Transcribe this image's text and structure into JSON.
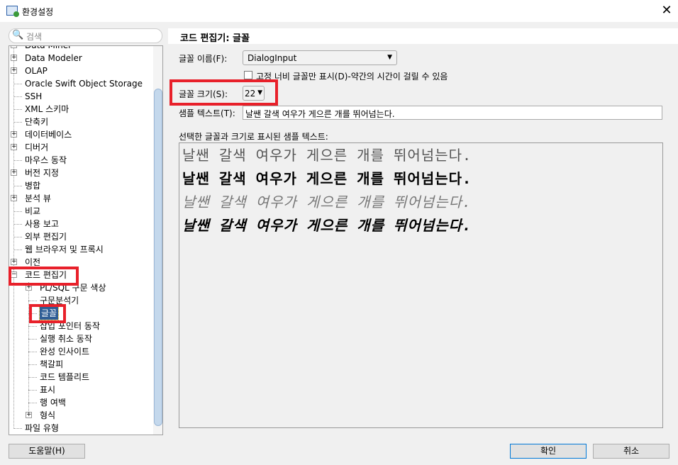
{
  "window": {
    "title": "환경설정",
    "close_glyph": "✕"
  },
  "search": {
    "placeholder": "검색"
  },
  "tree": {
    "items": [
      {
        "label": "Data Miner",
        "level": 0,
        "expander": "+"
      },
      {
        "label": "Data Modeler",
        "level": 0,
        "expander": "+"
      },
      {
        "label": "OLAP",
        "level": 0,
        "expander": "+"
      },
      {
        "label": "Oracle Swift Object Storage",
        "level": 0
      },
      {
        "label": "SSH",
        "level": 0
      },
      {
        "label": "XML 스키마",
        "level": 0
      },
      {
        "label": "단축키",
        "level": 0
      },
      {
        "label": "데이터베이스",
        "level": 0,
        "expander": "+"
      },
      {
        "label": "디버거",
        "level": 0,
        "expander": "+"
      },
      {
        "label": "마우스 동작",
        "level": 0
      },
      {
        "label": "버전 지정",
        "level": 0,
        "expander": "+"
      },
      {
        "label": "병합",
        "level": 0
      },
      {
        "label": "분석 뷰",
        "level": 0,
        "expander": "+"
      },
      {
        "label": "비교",
        "level": 0
      },
      {
        "label": "사용 보고",
        "level": 0
      },
      {
        "label": "외부 편집기",
        "level": 0
      },
      {
        "label": "웹 브라우저 및 프록시",
        "level": 0
      },
      {
        "label": "이전",
        "level": 0,
        "expander": "+"
      },
      {
        "label": "코드 편집기",
        "level": 0,
        "expander": "-"
      },
      {
        "label": "PL/SQL 구문 색상",
        "level": 1,
        "expander": "+"
      },
      {
        "label": "구문분석기",
        "level": 1
      },
      {
        "label": "글꼴",
        "level": 1,
        "selected": true
      },
      {
        "label": "삽입 포인터 동작",
        "level": 1
      },
      {
        "label": "실행 취소 동작",
        "level": 1
      },
      {
        "label": "완성 인사이트",
        "level": 1
      },
      {
        "label": "책갈피",
        "level": 1
      },
      {
        "label": "코드 템플리트",
        "level": 1
      },
      {
        "label": "표시",
        "level": 1
      },
      {
        "label": "행 여백",
        "level": 1
      },
      {
        "label": "형식",
        "level": 1,
        "expander": "+"
      },
      {
        "label": "파일 유형",
        "level": 0
      }
    ]
  },
  "panel": {
    "header": "코드 편집기: 글꼴",
    "font_name_label": "글꼴 이름(F):",
    "font_name_value": "DialogInput",
    "fixed_width_label": "고정 너비 글꼴만 표시(D)-약간의 시간이 걸릴 수 있음",
    "fixed_width_checked": false,
    "font_size_label": "글꼴 크기(S):",
    "font_size_value": "22",
    "sample_label": "샘플 텍스트(T):",
    "sample_value": "날쌘 갈색 여우가 게으른 개를 뛰어넘는다.",
    "preview_label": "선택한 글꼴과 크기로 표시된 샘플 텍스트:",
    "preview_lines": [
      {
        "text": "날쌘 갈색 여우가 게으른 개를 뛰어넘는다.",
        "style": "plain"
      },
      {
        "text": "날쌘 갈색 여우가 게으른 개를 뛰어넘는다.",
        "style": "bold"
      },
      {
        "text": "날쌘 갈색 여우가 게으른 개를 뛰어넘는다.",
        "style": "italic"
      },
      {
        "text": "날쌘 갈색 여우가 게으른 개를 뛰어넘는다.",
        "style": "bold-italic"
      }
    ]
  },
  "buttons": {
    "help": "도움말(H)",
    "ok": "확인",
    "cancel": "취소"
  },
  "colors": {
    "highlight": "#e8202a",
    "selection": "#2f5d95"
  }
}
